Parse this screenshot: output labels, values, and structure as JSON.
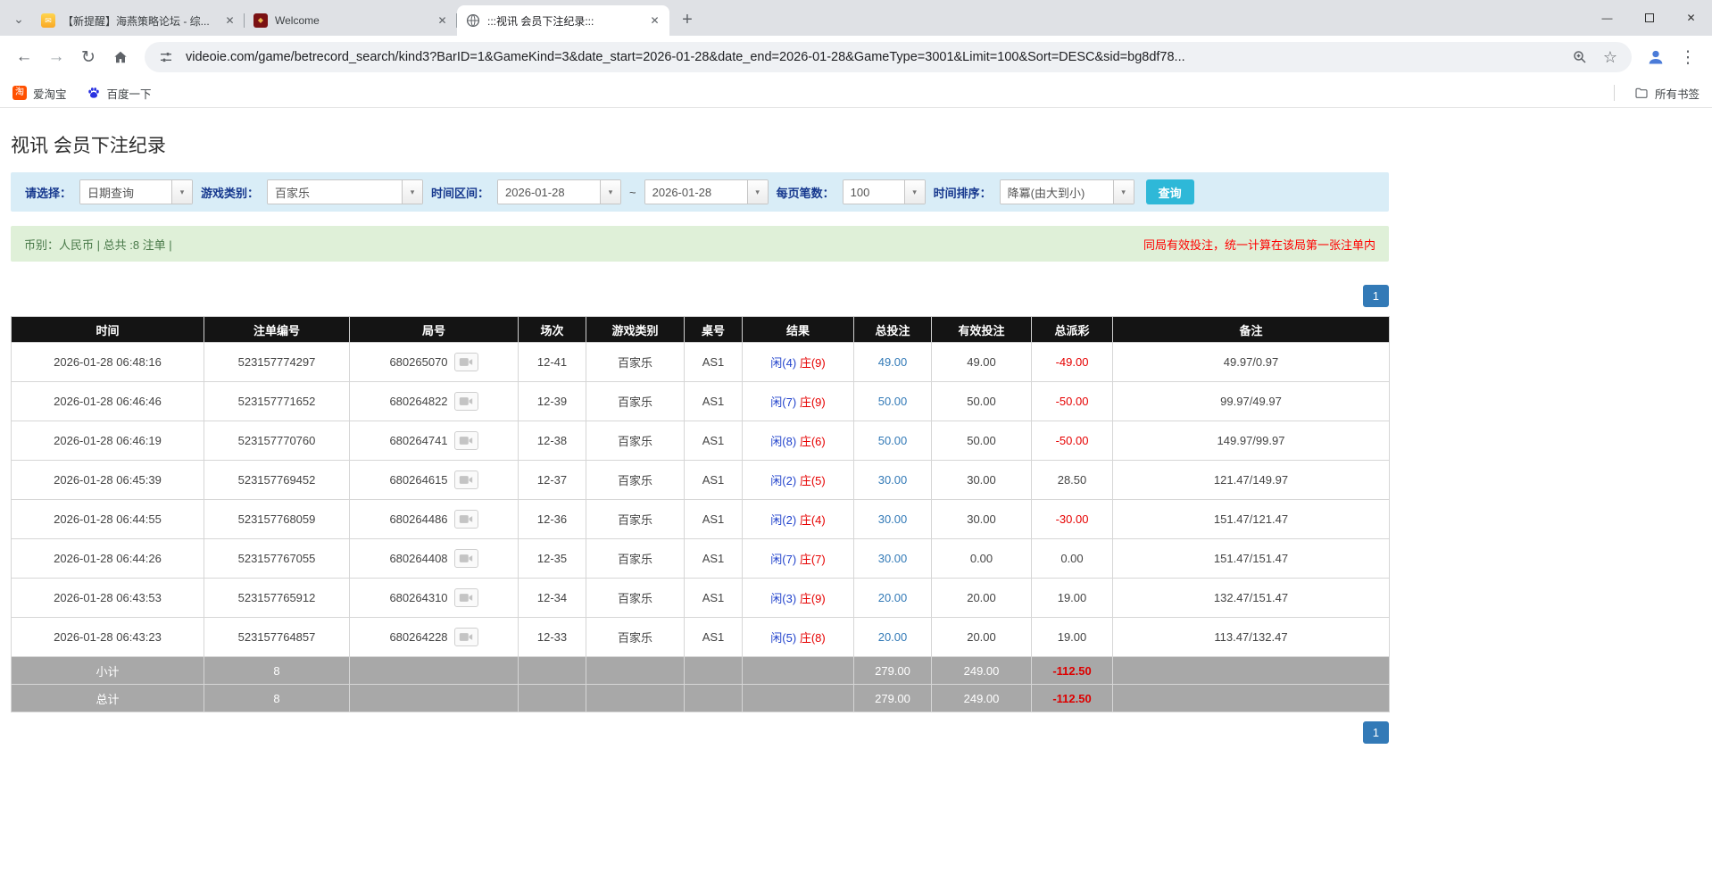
{
  "colors": {
    "accent_blue": "#337ab7",
    "negative_red": "#e60000",
    "player_blue": "#2243cc",
    "banker_red": "#e60000",
    "search_button_cyan": "#2eb8d8",
    "filter_bar_bg": "#d9edf7",
    "info_bar_bg": "#dff0d8",
    "table_header_bg": "#141414",
    "summary_row_bg": "#a8a8a8",
    "pagination_blue": "#337ab7"
  },
  "icons": {
    "tab_search": "⌄",
    "close": "✕",
    "minimize": "—",
    "new_tab": "+",
    "back": "←",
    "forward": "→",
    "reload": "↻",
    "star": "☆",
    "menu": "⋮",
    "dropdown": "▾",
    "taobao_glyph": "淘",
    "envelope_glyph": "✉",
    "diamond_glyph": "◆"
  },
  "browser": {
    "tabs": [
      {
        "title": "【新提醒】海燕策略论坛 - 综..."
      },
      {
        "title": "Welcome"
      },
      {
        "title": ":::视讯 会员下注纪录:::"
      }
    ],
    "url": "videoie.com/game/betrecord_search/kind3?BarID=1&GameKind=3&date_start=2026-01-28&date_end=2026-01-28&GameType=3001&Limit=100&Sort=DESC&sid=bg8df78...",
    "bookmarks": {
      "taobao": "爱淘宝",
      "baidu": "百度一下",
      "all_bookmarks": "所有书签"
    }
  },
  "page": {
    "title": "视讯 会员下注纪录",
    "filters": {
      "select_label": "请选择：",
      "select_value": "日期查询",
      "game_label": "游戏类别：",
      "game_value": "百家乐",
      "range_label": "时间区间：",
      "date_start": "2026-01-28",
      "range_separator": "~",
      "date_end": "2026-01-28",
      "per_page_label": "每页笔数：",
      "per_page_value": "100",
      "sort_label": "时间排序：",
      "sort_value": "降冪(由大到小)",
      "search_button": "查询"
    },
    "info_bar": {
      "left": "币别：人民币 | 总共 :8 注单 |",
      "right": "同局有效投注，统一计算在该局第一张注单内"
    },
    "pagination": "1",
    "table": {
      "headers": [
        "时间",
        "注单编号",
        "局号",
        "场次",
        "游戏类别",
        "桌号",
        "结果",
        "总投注",
        "有效投注",
        "总派彩",
        "备注"
      ],
      "rows": [
        {
          "time": "2026-01-28 06:48:16",
          "bet_id": "523157774297",
          "round": "680265070",
          "session": "12-41",
          "game": "百家乐",
          "table_no": "AS1",
          "result_player": "闲(4)",
          "result_banker": "庄(9)",
          "total_bet": "49.00",
          "valid_bet": "49.00",
          "payout": "-49.00",
          "remark": "49.97/0.97"
        },
        {
          "time": "2026-01-28 06:46:46",
          "bet_id": "523157771652",
          "round": "680264822",
          "session": "12-39",
          "game": "百家乐",
          "table_no": "AS1",
          "result_player": "闲(7)",
          "result_banker": "庄(9)",
          "total_bet": "50.00",
          "valid_bet": "50.00",
          "payout": "-50.00",
          "remark": "99.97/49.97"
        },
        {
          "time": "2026-01-28 06:46:19",
          "bet_id": "523157770760",
          "round": "680264741",
          "session": "12-38",
          "game": "百家乐",
          "table_no": "AS1",
          "result_player": "闲(8)",
          "result_banker": "庄(6)",
          "total_bet": "50.00",
          "valid_bet": "50.00",
          "payout": "-50.00",
          "remark": "149.97/99.97"
        },
        {
          "time": "2026-01-28 06:45:39",
          "bet_id": "523157769452",
          "round": "680264615",
          "session": "12-37",
          "game": "百家乐",
          "table_no": "AS1",
          "result_player": "闲(2)",
          "result_banker": "庄(5)",
          "total_bet": "30.00",
          "valid_bet": "30.00",
          "payout": "28.50",
          "remark": "121.47/149.97"
        },
        {
          "time": "2026-01-28 06:44:55",
          "bet_id": "523157768059",
          "round": "680264486",
          "session": "12-36",
          "game": "百家乐",
          "table_no": "AS1",
          "result_player": "闲(2)",
          "result_banker": "庄(4)",
          "total_bet": "30.00",
          "valid_bet": "30.00",
          "payout": "-30.00",
          "remark": "151.47/121.47"
        },
        {
          "time": "2026-01-28 06:44:26",
          "bet_id": "523157767055",
          "round": "680264408",
          "session": "12-35",
          "game": "百家乐",
          "table_no": "AS1",
          "result_player": "闲(7)",
          "result_banker": "庄(7)",
          "total_bet": "30.00",
          "valid_bet": "0.00",
          "payout": "0.00",
          "remark": "151.47/151.47"
        },
        {
          "time": "2026-01-28 06:43:53",
          "bet_id": "523157765912",
          "round": "680264310",
          "session": "12-34",
          "game": "百家乐",
          "table_no": "AS1",
          "result_player": "闲(3)",
          "result_banker": "庄(9)",
          "total_bet": "20.00",
          "valid_bet": "20.00",
          "payout": "19.00",
          "remark": "132.47/151.47"
        },
        {
          "time": "2026-01-28 06:43:23",
          "bet_id": "523157764857",
          "round": "680264228",
          "session": "12-33",
          "game": "百家乐",
          "table_no": "AS1",
          "result_player": "闲(5)",
          "result_banker": "庄(8)",
          "total_bet": "20.00",
          "valid_bet": "20.00",
          "payout": "19.00",
          "remark": "113.47/132.47"
        }
      ],
      "subtotal": {
        "label": "小计",
        "count": "8",
        "total_bet": "279.00",
        "valid_bet": "249.00",
        "payout": "-112.50"
      },
      "total": {
        "label": "总计",
        "count": "8",
        "total_bet": "279.00",
        "valid_bet": "249.00",
        "payout": "-112.50"
      }
    }
  }
}
